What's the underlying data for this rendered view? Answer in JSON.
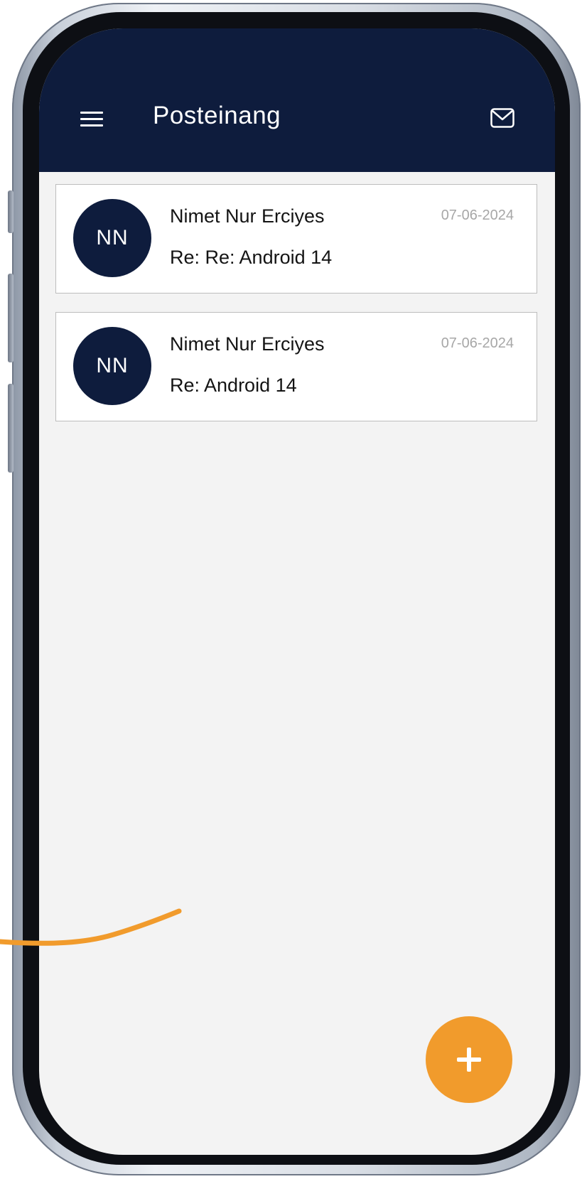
{
  "header": {
    "title": "Posteinang",
    "menu_icon": "hamburger-menu-icon",
    "action_icon": "mail-icon"
  },
  "messages": [
    {
      "initials": "NN",
      "sender": "Nimet Nur Erciyes",
      "subject": "Re: Re: Android 14",
      "date": "07-06-2024"
    },
    {
      "initials": "NN",
      "sender": "Nimet Nur Erciyes",
      "subject": "Re: Android 14",
      "date": "07-06-2024"
    }
  ],
  "fab": {
    "icon": "plus-icon"
  },
  "colors": {
    "header_bg": "#0e1c3d",
    "avatar_bg": "#0e1c3d",
    "screen_bg": "#f3f3f3",
    "accent": "#f19b2c",
    "date_text": "#a7a7a7"
  }
}
